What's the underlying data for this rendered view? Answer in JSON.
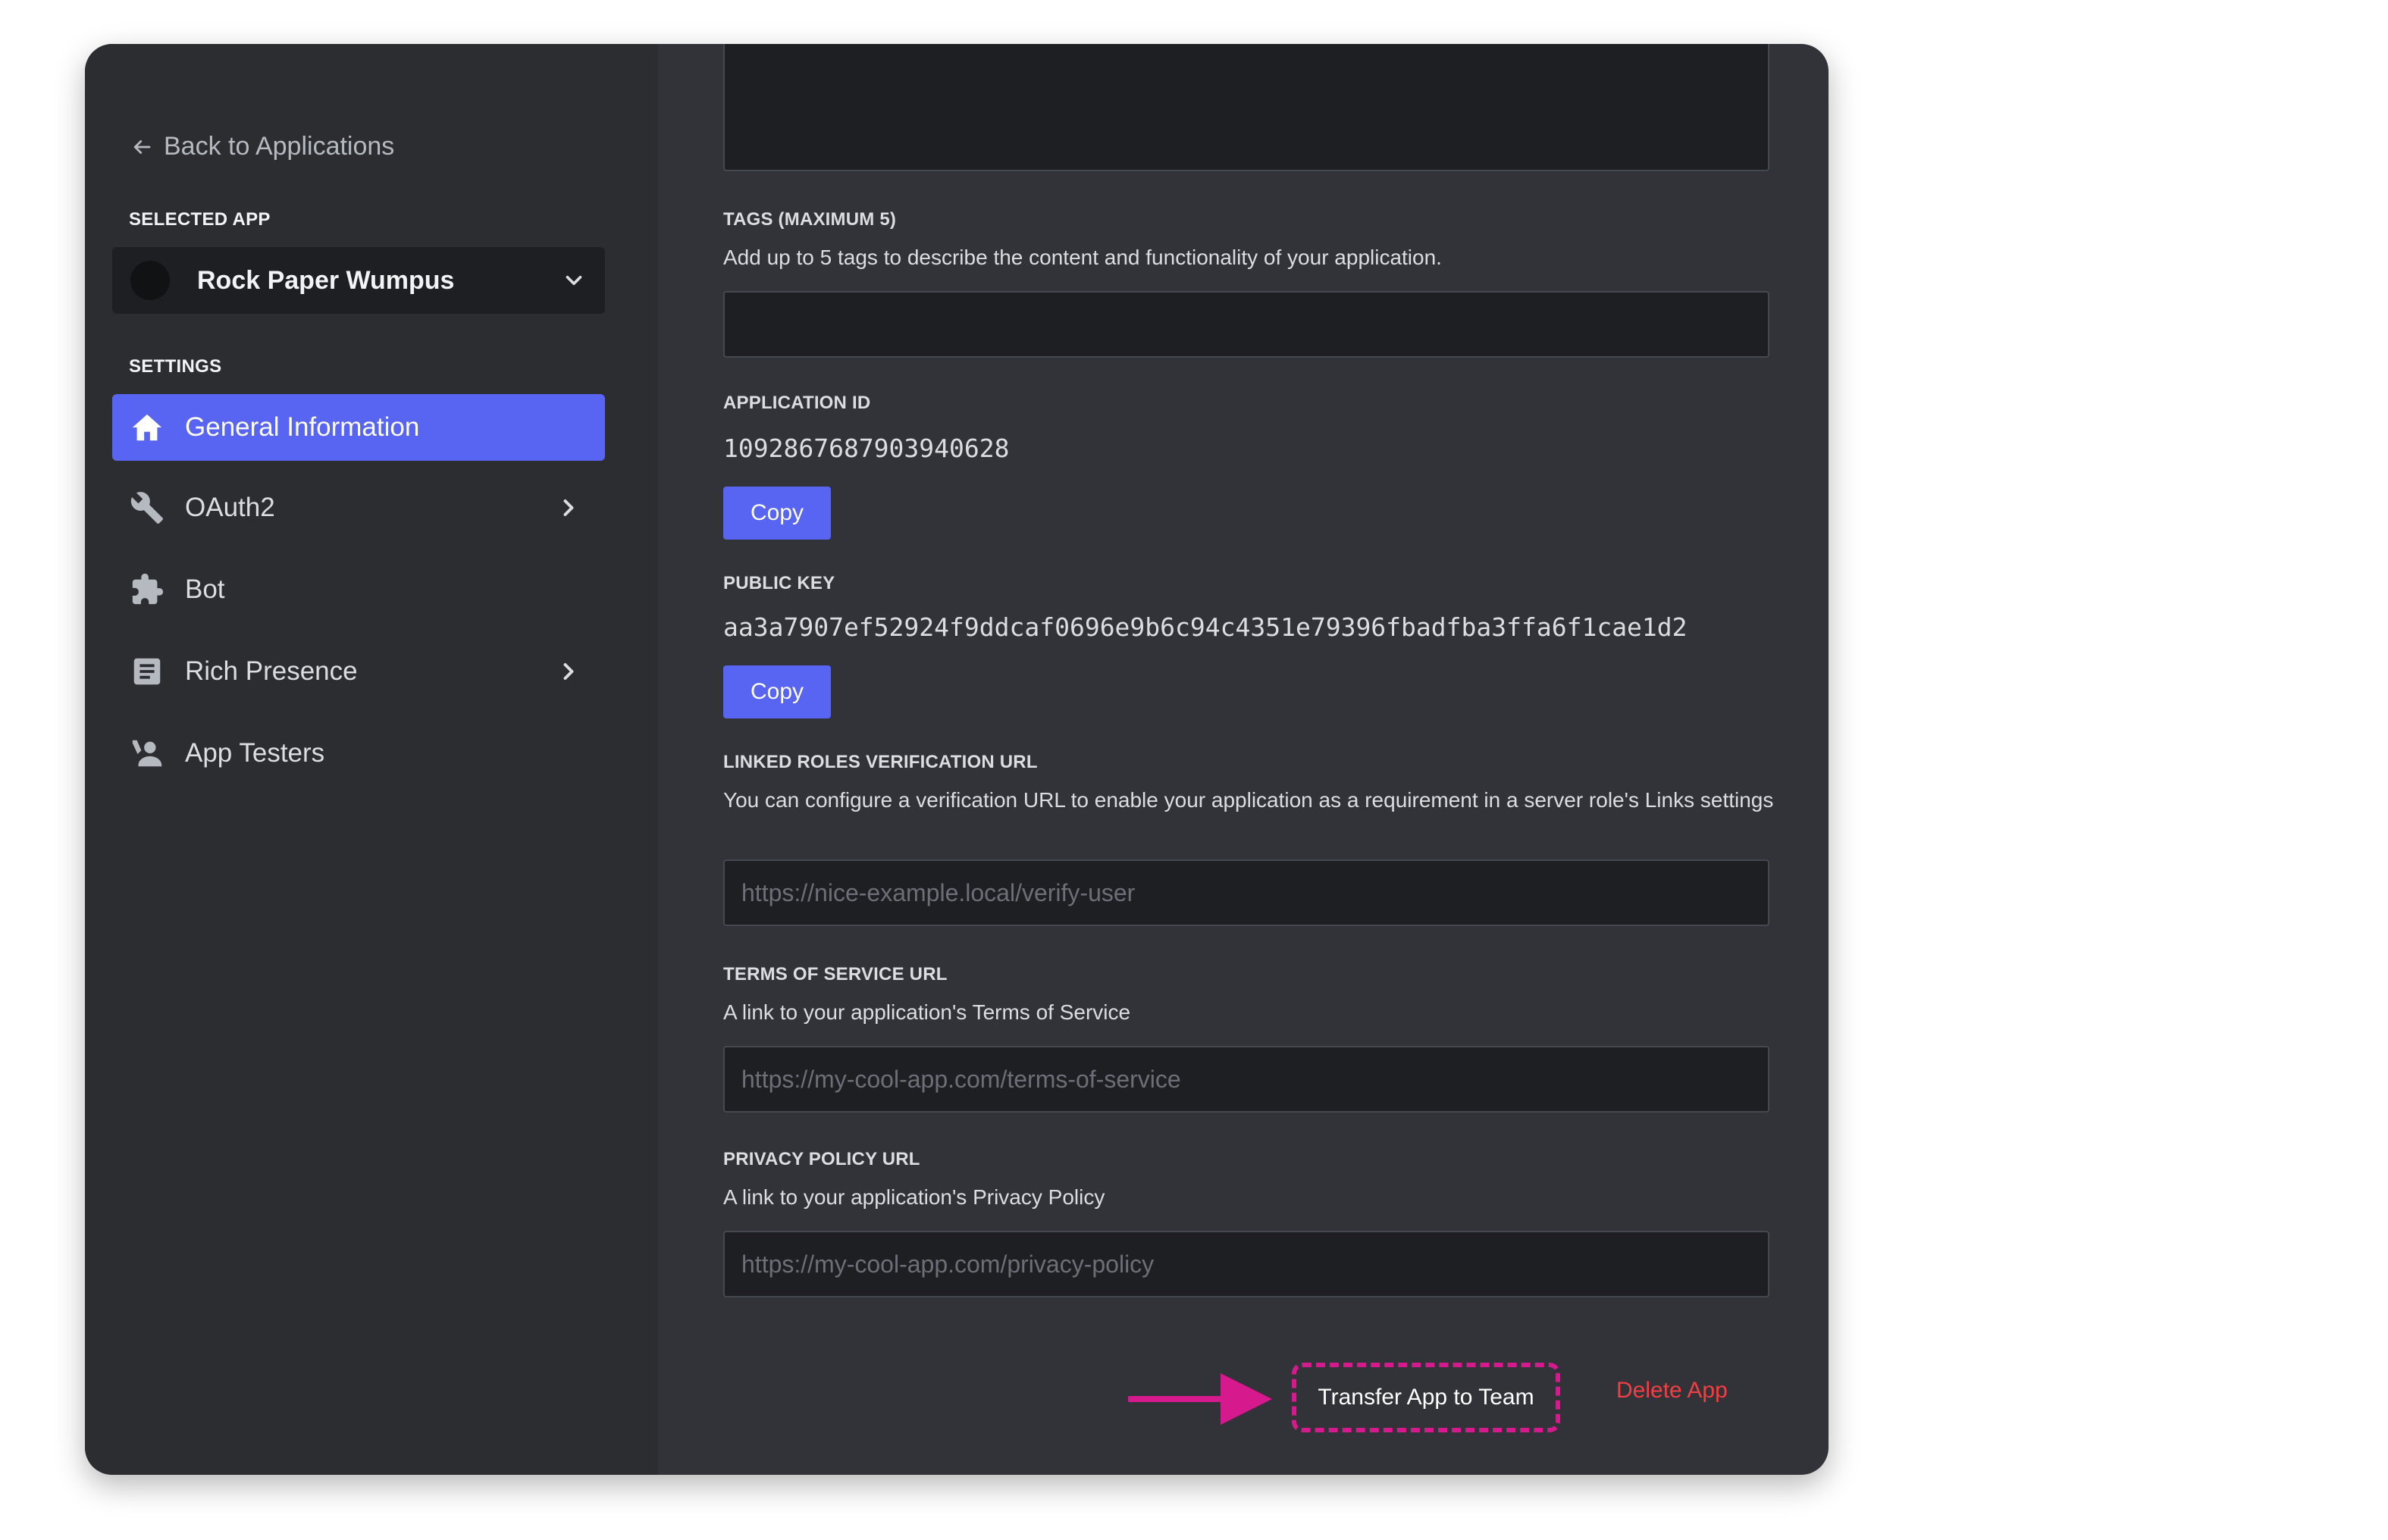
{
  "colors": {
    "accent": "#5865f2",
    "danger": "#f23f43",
    "annotation": "#d6198c",
    "sidebar_bg": "#2b2d31",
    "main_bg": "#313338"
  },
  "sidebar": {
    "back_label": "Back to Applications",
    "selected_app_heading": "SELECTED APP",
    "selected_app_name": "Rock Paper Wumpus",
    "settings_heading": "SETTINGS",
    "items": [
      {
        "label": "General Information",
        "icon": "home-icon",
        "active": true,
        "has_chevron": false
      },
      {
        "label": "OAuth2",
        "icon": "wrench-icon",
        "active": false,
        "has_chevron": true
      },
      {
        "label": "Bot",
        "icon": "puzzle-icon",
        "active": false,
        "has_chevron": false
      },
      {
        "label": "Rich Presence",
        "icon": "document-icon",
        "active": false,
        "has_chevron": true
      },
      {
        "label": "App Testers",
        "icon": "person-icon",
        "active": false,
        "has_chevron": false
      }
    ]
  },
  "main": {
    "tags": {
      "label": "TAGS (MAXIMUM 5)",
      "description": "Add up to 5 tags to describe the content and functionality of your application.",
      "value": ""
    },
    "application_id": {
      "label": "APPLICATION ID",
      "value": "1092867687903940628",
      "copy_label": "Copy"
    },
    "public_key": {
      "label": "PUBLIC KEY",
      "value": "aa3a7907ef52924f9ddcaf0696e9b6c94c4351e79396fbadfba3ffa6f1cae1d2",
      "copy_label": "Copy"
    },
    "linked_roles": {
      "label": "LINKED ROLES VERIFICATION URL",
      "description": "You can configure a verification URL to enable your application as a requirement in a server role's Links settings",
      "placeholder": "https://nice-example.local/verify-user"
    },
    "terms": {
      "label": "TERMS OF SERVICE URL",
      "description": "A link to your application's Terms of Service",
      "placeholder": "https://my-cool-app.com/terms-of-service"
    },
    "privacy": {
      "label": "PRIVACY POLICY URL",
      "description": "A link to your application's Privacy Policy",
      "placeholder": "https://my-cool-app.com/privacy-policy"
    },
    "actions": {
      "transfer_label": "Transfer App to Team",
      "delete_label": "Delete App"
    }
  }
}
